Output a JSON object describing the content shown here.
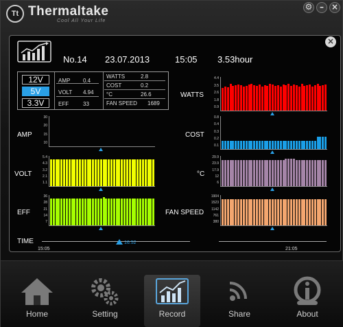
{
  "brand": {
    "mark": "Tt",
    "name": "Thermaltake",
    "tagline": "Cool All Your Life"
  },
  "window_controls": [
    {
      "name": "settings",
      "glyph": "⚙"
    },
    {
      "name": "minimize",
      "glyph": "–"
    },
    {
      "name": "close",
      "glyph": "×"
    }
  ],
  "panel_close_glyph": "×",
  "header": {
    "record_no": "No.14",
    "date": "23.07.2013",
    "time": "15:05",
    "duration": "3.53hour"
  },
  "voltage_rails": [
    {
      "label": "12V",
      "active": false
    },
    {
      "label": "5V",
      "active": true
    },
    {
      "label": "3.3V",
      "active": false
    }
  ],
  "readings_left": [
    {
      "label": "AMP",
      "value": "0.4"
    },
    {
      "label": "VOLT",
      "value": "4.94"
    },
    {
      "label": "EFF",
      "value": "33"
    }
  ],
  "readings_right": [
    {
      "label": "WATTS",
      "value": "2.8"
    },
    {
      "label": "COST",
      "value": "0.2"
    },
    {
      "label": "°C",
      "value": "26.6"
    },
    {
      "label": "FAN SPEED",
      "value": "1689"
    }
  ],
  "time_axis": {
    "label": "TIME",
    "start": "15:05",
    "end": "21:05",
    "cursor": "16:52"
  },
  "nav": [
    {
      "label": "Home",
      "icon": "home-icon",
      "active": false
    },
    {
      "label": "Setting",
      "icon": "gears-icon",
      "active": false
    },
    {
      "label": "Record",
      "icon": "chart-icon",
      "active": true
    },
    {
      "label": "Share",
      "icon": "share-icon",
      "active": false
    },
    {
      "label": "About",
      "icon": "about-icon",
      "active": false
    }
  ],
  "chart_data": [
    {
      "id": "amp",
      "type": "bar",
      "title": "AMP",
      "color": "#ffff00",
      "y_ticks": [
        "30",
        "20",
        "15",
        "10"
      ],
      "ylim": [
        0,
        30
      ],
      "values": []
    },
    {
      "id": "volt",
      "type": "bar",
      "title": "VOLT",
      "color": "#f2ff00",
      "y_ticks": [
        "5.4",
        "4.3",
        "3.2",
        "2.1",
        "1.1"
      ],
      "ylim": [
        0,
        5.4
      ],
      "values": [
        4.94,
        4.94,
        4.94,
        4.94,
        4.94,
        4.94,
        4.94,
        4.94,
        4.94,
        4.94,
        4.94,
        4.94,
        4.94,
        4.94,
        4.94,
        4.94,
        4.94,
        4.94,
        4.94,
        4.94,
        4.94,
        4.94,
        4.94,
        4.94,
        4.94,
        4.94,
        4.94,
        4.94,
        4.94,
        4.94,
        4.94,
        4.94,
        4.94,
        4.94,
        4.94,
        4.94,
        4.94,
        4.94,
        4.94,
        4.94
      ]
    },
    {
      "id": "eff",
      "type": "bar",
      "title": "EFF",
      "color": "#a6ff00",
      "y_ticks": [
        "36",
        "28",
        "21",
        "14",
        "7"
      ],
      "ylim": [
        0,
        36
      ],
      "values": [
        33,
        33,
        33,
        33,
        33,
        33,
        33,
        33,
        33,
        33,
        33,
        33,
        33,
        33,
        33,
        33,
        33,
        33,
        33,
        33,
        34,
        33,
        33,
        33,
        33,
        33,
        33,
        33,
        33,
        33,
        33,
        33,
        33,
        33,
        33,
        33,
        33,
        33,
        33,
        33
      ]
    },
    {
      "id": "watts",
      "type": "bar",
      "title": "WATTS",
      "color": "#ff0000",
      "y_ticks": [
        "4.4",
        "3.5",
        "2.6",
        "1.8",
        "0.9"
      ],
      "ylim": [
        0,
        4.4
      ],
      "values": [
        3.0,
        3.2,
        3.1,
        3.6,
        3.3,
        3.4,
        3.5,
        3.4,
        3.2,
        3.3,
        3.5,
        3.6,
        3.4,
        3.3,
        3.5,
        3.2,
        3.4,
        3.3,
        3.6,
        3.5,
        3.3,
        3.4,
        3.2,
        3.5,
        3.4,
        3.6,
        3.3,
        3.5,
        3.4,
        3.2,
        3.6,
        3.3,
        3.4,
        3.5,
        3.2,
        3.4,
        3.6,
        3.3,
        3.4,
        3.5
      ]
    },
    {
      "id": "cost",
      "type": "bar",
      "title": "COST",
      "color": "#1a9fe8",
      "y_ticks": [
        "0.8",
        "0.4",
        "0.3",
        "0.2",
        "0.1"
      ],
      "ylim": [
        0,
        0.8
      ],
      "values": [
        0.2,
        0.2,
        0.2,
        0.2,
        0.2,
        0.2,
        0.2,
        0.2,
        0.2,
        0.2,
        0.2,
        0.2,
        0.2,
        0.2,
        0.2,
        0.2,
        0.2,
        0.2,
        0.2,
        0.2,
        0.2,
        0.2,
        0.2,
        0.2,
        0.2,
        0.2,
        0.2,
        0.2,
        0.2,
        0.2,
        0.2,
        0.2,
        0.2,
        0.2,
        0.2,
        0.2,
        0.3,
        0.3,
        0.3,
        0.3
      ]
    },
    {
      "id": "temp",
      "type": "bar",
      "title": "°C",
      "color": "#a585a8",
      "y_ticks": [
        "29.9",
        "23.9",
        "17.9",
        "12",
        "6"
      ],
      "ylim": [
        0,
        29.9
      ],
      "values": [
        26.6,
        26.6,
        26.6,
        26.6,
        26.6,
        26.6,
        26.6,
        26.6,
        26.6,
        26.6,
        26.6,
        26.6,
        26.6,
        26.6,
        26.6,
        26.6,
        26.6,
        26.6,
        26.6,
        26.6,
        26.6,
        26.6,
        26.6,
        26.6,
        27.5,
        27.5,
        27.5,
        27.5,
        26.6,
        26.6,
        26.6,
        26.6,
        26.6,
        26.6,
        26.6,
        26.6,
        26.6,
        26.6,
        26.6,
        26.6
      ]
    },
    {
      "id": "fan",
      "type": "bar",
      "title": "FAN SPEED",
      "color": "#f4a66f",
      "y_ticks": [
        "1904",
        "1523",
        "1142",
        "761",
        "380"
      ],
      "ylim": [
        0,
        1904
      ],
      "values": [
        1689,
        1689,
        1689,
        1689,
        1689,
        1689,
        1689,
        1689,
        1689,
        1689,
        1689,
        1689,
        1689,
        1689,
        1689,
        1689,
        1689,
        1689,
        1689,
        1689,
        1689,
        1689,
        1689,
        1689,
        1689,
        1689,
        1689,
        1689,
        1689,
        1689,
        1689,
        1689,
        1689,
        1689,
        1689,
        1689,
        1689,
        1689,
        1689,
        1689
      ]
    }
  ]
}
